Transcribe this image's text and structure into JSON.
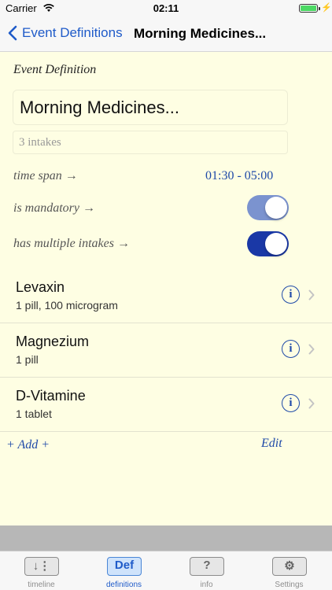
{
  "status_bar": {
    "carrier": "Carrier",
    "time": "02:11"
  },
  "nav": {
    "back_label": "Event Definitions",
    "title": "Morning Medicines..."
  },
  "form": {
    "section_label": "Event Definition",
    "name_value": "Morning Medicines...",
    "intakes_value": "3 intakes",
    "time_span_label": "time span →",
    "time_span_value": "01:30 - 05:00",
    "mandatory_label": "is mandatory →",
    "mandatory_on": true,
    "multiple_label": "has multiple intakes →",
    "multiple_on": true
  },
  "items": [
    {
      "name": "Levaxin",
      "detail": "1 pill, 100 microgram"
    },
    {
      "name": "Magnezium",
      "detail": "1 pill"
    },
    {
      "name": "D-Vitamine",
      "detail": "1 tablet"
    }
  ],
  "actions": {
    "add_label": "+ Add +",
    "edit_label": "Edit"
  },
  "tabs": [
    {
      "label": "timeline",
      "glyph": "↓⋮",
      "icon": "timeline-icon",
      "active": false
    },
    {
      "label": "definitions",
      "glyph": "Def",
      "icon": "definitions-icon",
      "active": true
    },
    {
      "label": "info",
      "glyph": "?",
      "icon": "question-icon",
      "active": false
    },
    {
      "label": "Settings",
      "glyph": "⚙",
      "icon": "gear-icon",
      "active": false
    }
  ],
  "colors": {
    "accent": "#1f4aa8",
    "background": "#fefee3",
    "toggle_dark": "#1a38a6",
    "toggle_light": "#7b93cf"
  }
}
